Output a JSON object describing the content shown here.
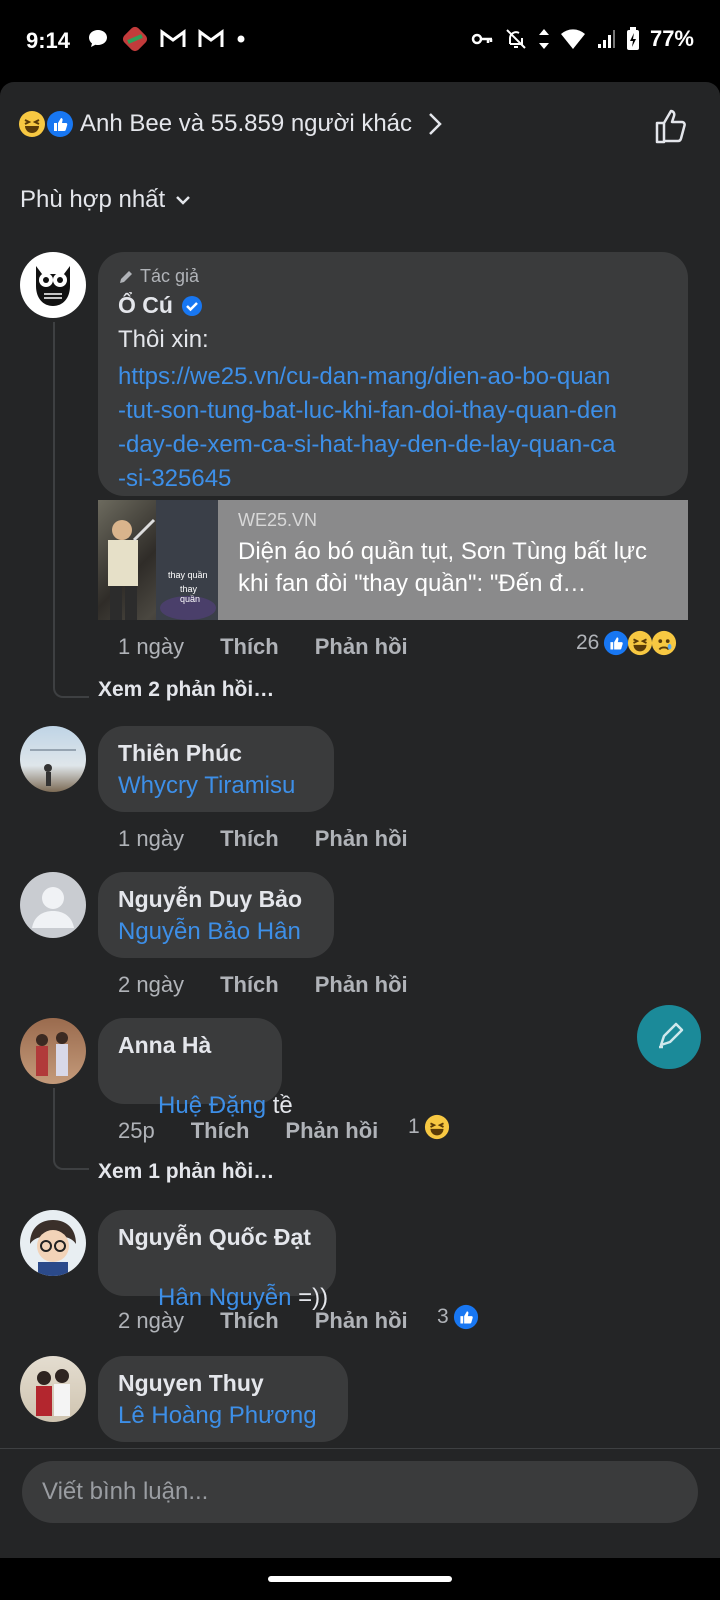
{
  "status_bar": {
    "time": "9:14",
    "battery": "77%"
  },
  "reactions_header": {
    "summary": "Anh Bee và 55.859 người khác"
  },
  "sort": {
    "label": "Phù hợp nhất"
  },
  "comments": [
    {
      "author_tag": "Tác giả",
      "name": "Ổ Cú",
      "text": "Thôi xin:",
      "link": "https://we25.vn/cu-dan-mang/dien-ao-bo-quan-tut-son-tung-bat-luc-khi-fan-doi-thay-quan-den-day-de-xem-ca-si-hat-hay-den-de-lay-quan-ca-si-325645",
      "link_lines": [
        "https://we25.vn/cu-dan-mang/dien-ao-bo-quan",
        "-tut-son-tung-bat-luc-khi-fan-doi-thay-quan-den",
        "-day-de-xem-ca-si-hat-hay-den-de-lay-quan-ca",
        "-si-325645"
      ],
      "preview": {
        "source": "WE25.VN",
        "title": "Diện áo bó quần tụt, Sơn Tùng bất lực khi fan đòi \"thay quần\": \"Đến đ…",
        "thumb_text_1": "thay quần",
        "thumb_text_2": "thay quần"
      },
      "time": "1 ngày",
      "like": "Thích",
      "reply": "Phản hồi",
      "reactions": "26",
      "view_replies": "Xem 2 phản hồi…"
    },
    {
      "name": "Thiên Phúc",
      "mention": "Whycry Tiramisu",
      "text": "",
      "time": "1 ngày",
      "like": "Thích",
      "reply": "Phản hồi"
    },
    {
      "name": "Nguyễn Duy Bảo",
      "mention": "Nguyễn Bảo Hân",
      "text": "",
      "time": "2 ngày",
      "like": "Thích",
      "reply": "Phản hồi"
    },
    {
      "name": "Anna Hà",
      "mention": "Huệ Đặng",
      "text": " tề",
      "time": "25p",
      "like": "Thích",
      "reply": "Phản hồi",
      "reactions": "1",
      "view_replies": "Xem 1 phản hồi…"
    },
    {
      "name": "Nguyễn Quốc Đạt",
      "mention": "Hân Nguyễn",
      "text": " =))",
      "time": "2 ngày",
      "like": "Thích",
      "reply": "Phản hồi",
      "reactions": "3"
    },
    {
      "name": "Nguyen Thuy",
      "mention": "Lê Hoàng Phương",
      "text": ""
    }
  ],
  "composer": {
    "placeholder": "Viết bình luận..."
  },
  "colors": {
    "link": "#3d8fe8",
    "bubble": "#3a3b3c",
    "sheet": "#242526",
    "like_blue": "#1877f2",
    "fab": "#1b8a99"
  }
}
